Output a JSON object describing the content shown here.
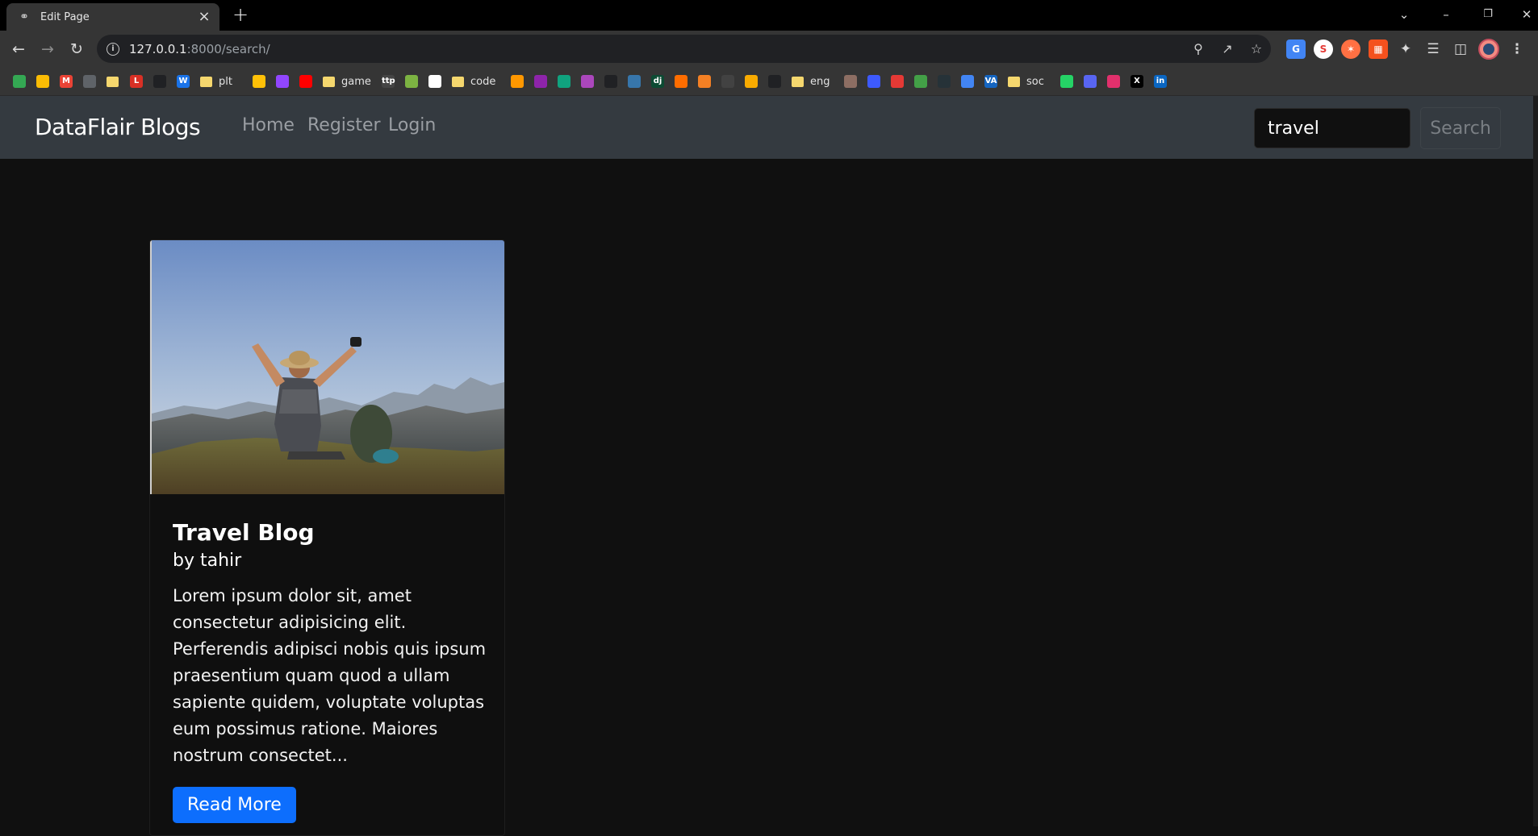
{
  "browser": {
    "tab_title": "Edit Page",
    "new_tab_symbol": "+",
    "url_host": "127.0.0.1",
    "url_path": ":8000/search/",
    "bookmarks": [
      {
        "kind": "icon",
        "icon": "maps-icon",
        "color": "#34a853",
        "text": ""
      },
      {
        "kind": "icon",
        "icon": "keep-icon",
        "color": "#fbbc04",
        "text": ""
      },
      {
        "kind": "icon",
        "icon": "gmail-icon",
        "color": "#ea4335",
        "text": "M"
      },
      {
        "kind": "icon",
        "icon": "globe-icon",
        "color": "#5f6368",
        "text": ""
      },
      {
        "kind": "folder",
        "icon": "folder-icon",
        "text": ""
      },
      {
        "kind": "icon",
        "icon": "l-icon",
        "color": "#d93025",
        "text": "L"
      },
      {
        "kind": "icon",
        "icon": "github-alt-icon",
        "color": "#202124",
        "text": ""
      },
      {
        "kind": "icon",
        "icon": "word-icon",
        "color": "#1a73e8",
        "text": "W"
      },
      {
        "kind": "folder",
        "icon": "folder-icon",
        "text": "plt"
      },
      {
        "kind": "icon",
        "icon": "play-icon",
        "color": "#ffc107",
        "text": ""
      },
      {
        "kind": "icon",
        "icon": "twitch-icon",
        "color": "#9146ff",
        "text": ""
      },
      {
        "kind": "icon",
        "icon": "youtube-icon",
        "color": "#ff0000",
        "text": ""
      },
      {
        "kind": "folder",
        "icon": "folder-icon",
        "text": "game"
      },
      {
        "kind": "icon",
        "icon": "ttp-icon",
        "color": "#444444",
        "text": "ttp"
      },
      {
        "kind": "icon",
        "icon": "figure-icon",
        "color": "#7cb342",
        "text": ""
      },
      {
        "kind": "icon",
        "icon": "notion-icon",
        "color": "#ffffff",
        "text": ""
      },
      {
        "kind": "folder",
        "icon": "folder-icon",
        "text": "code"
      },
      {
        "kind": "icon",
        "icon": "layers-icon",
        "color": "#ff9800",
        "text": ""
      },
      {
        "kind": "icon",
        "icon": "sparkle-icon",
        "color": "#8e24aa",
        "text": ""
      },
      {
        "kind": "icon",
        "icon": "chatgpt-icon",
        "color": "#10a37f",
        "text": ""
      },
      {
        "kind": "icon",
        "icon": "bot-icon",
        "color": "#ab47bc",
        "text": ""
      },
      {
        "kind": "icon",
        "icon": "github-icon",
        "color": "#202124",
        "text": ""
      },
      {
        "kind": "icon",
        "icon": "python-icon",
        "color": "#3776ab",
        "text": ""
      },
      {
        "kind": "icon",
        "icon": "django-icon",
        "color": "#0c4b33",
        "text": "dj"
      },
      {
        "kind": "icon",
        "icon": "blocks-icon",
        "color": "#ff6d00",
        "text": ""
      },
      {
        "kind": "icon",
        "icon": "stackoverflow-icon",
        "color": "#f48024",
        "text": ""
      },
      {
        "kind": "icon",
        "icon": "frame-icon",
        "color": "#424242",
        "text": ""
      },
      {
        "kind": "icon",
        "icon": "colab-icon",
        "color": "#f9ab00",
        "text": ""
      },
      {
        "kind": "icon",
        "icon": "codepen-icon",
        "color": "#202124",
        "text": ""
      },
      {
        "kind": "folder",
        "icon": "folder-icon",
        "text": "eng"
      },
      {
        "kind": "icon",
        "icon": "person-icon",
        "color": "#8d6e63",
        "text": ""
      },
      {
        "kind": "icon",
        "icon": "circle-icon",
        "color": "#3d5afe",
        "text": ""
      },
      {
        "kind": "icon",
        "icon": "record-icon",
        "color": "#e53935",
        "text": ""
      },
      {
        "kind": "icon",
        "icon": "dots-icon",
        "color": "#43a047",
        "text": ""
      },
      {
        "kind": "icon",
        "icon": "dark-circle-icon",
        "color": "#263238",
        "text": ""
      },
      {
        "kind": "icon",
        "icon": "translate-icon",
        "color": "#4285f4",
        "text": ""
      },
      {
        "kind": "icon",
        "icon": "va-icon",
        "color": "#1565c0",
        "text": "VA"
      },
      {
        "kind": "folder",
        "icon": "folder-icon",
        "text": "soc"
      },
      {
        "kind": "icon",
        "icon": "whatsapp-icon",
        "color": "#25d366",
        "text": ""
      },
      {
        "kind": "icon",
        "icon": "discord-icon",
        "color": "#5865f2",
        "text": ""
      },
      {
        "kind": "icon",
        "icon": "instagram-icon",
        "color": "#e1306c",
        "text": ""
      },
      {
        "kind": "icon",
        "icon": "x-icon",
        "color": "#000000",
        "text": "X"
      },
      {
        "kind": "icon",
        "icon": "linkedin-icon",
        "color": "#0a66c2",
        "text": "in"
      }
    ]
  },
  "site": {
    "brand": "DataFlair Blogs",
    "nav": [
      "Home",
      "Register",
      "Login"
    ],
    "search": {
      "value": "travel",
      "button": "Search"
    }
  },
  "posts": [
    {
      "title": "Travel Blog",
      "author": "by tahir",
      "excerpt": "Lorem ipsum dolor sit, amet consectetur adipisicing elit. Perferendis adipisci nobis quis ipsum praesentium quam quod a ullam sapiente quidem, voluptate voluptas eum possimus ratione. Maiores nostrum consectet...",
      "cta": "Read More"
    }
  ],
  "colors": {
    "navbar": "#343a40",
    "page_bg": "#101010",
    "primary": "#0d6efd"
  }
}
